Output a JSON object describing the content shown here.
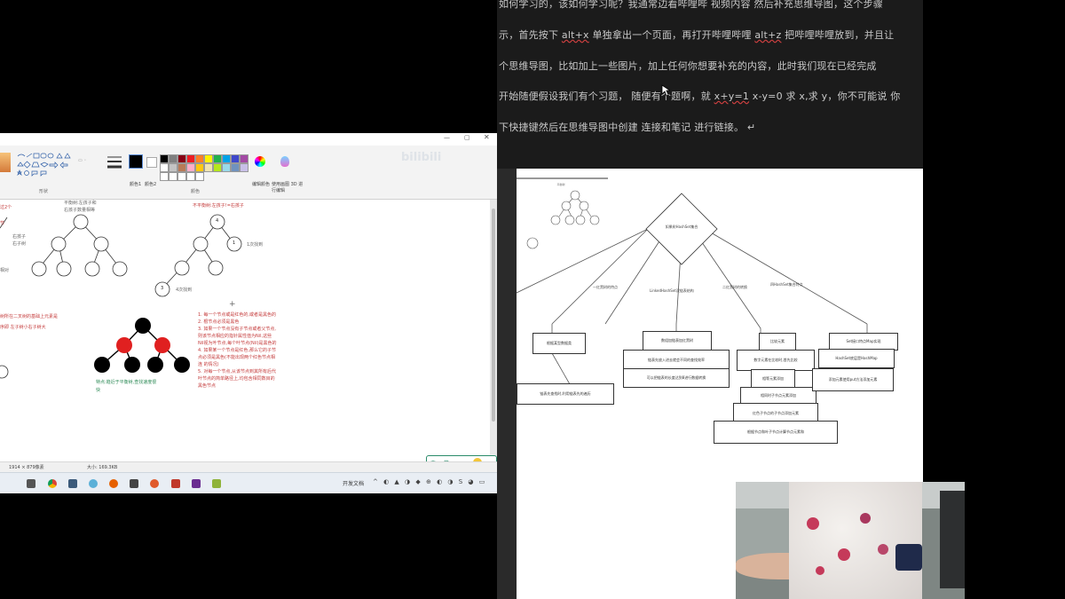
{
  "doc": {
    "line1": "如何学习的，该如何学习呢？我通常边看哔哩哔 视频内容 然后补充思维导图，这个步骤",
    "line2a": "示，首先按下",
    "key1": "alt+x",
    "line2b": "单独拿出一个页面，再打开哔哩哔哩",
    "key2": "alt+z",
    "line2c": "把哔哩哔哩放到，并且让",
    "line3": "个思维导图，比如加上一些图片，加上任何你想要补充的内容，此时我们现在已经完成",
    "line4a": "开始随便假设我们有个习题，  随便有个题啊，就",
    "line4b": "x+y=1",
    "line4c": "x-y=0  求 x,求 y，你不可能说  你",
    "line5": "下快捷键然后在思维导图中创建  连接和笔记  进行链接。 ↵"
  },
  "paint": {
    "ribbon_group_shapes": "形状",
    "ribbon_group_colors": "颜色",
    "ribbon_color1": "颜色1",
    "ribbon_color2": "颜色2",
    "ribbon_edit_colors": "编辑颜色",
    "ribbon_paint3d": "使用画图 3D 进行编辑",
    "canvas": {
      "left_t1": "过2个",
      "left_t2": "节",
      "left_child1": "右孩子",
      "left_child2": "右子树",
      "left_t3": "相对",
      "left_t4": "树所在二叉树的基础上元素是",
      "left_t5": "序即 左子树小右子树大",
      "balanced_title1": "平衡树:左孩子和",
      "balanced_title2": "右孩子数量相等",
      "unbalanced_title": "不平衡树:左孩子!=右孩子",
      "node4": "4",
      "node1": "1",
      "node1_label": "1次找到",
      "node3": "3",
      "node3_label": "4次找到",
      "rb_caption1": "特点:趋近于平衡树,查找速度很",
      "rb_caption2": "快",
      "rules": [
        "1. 每一个节点或是红色的,或者是黑色的",
        "2. 根节点必须是黑色",
        "3. 如果一个节点没有子节点或者父节点,",
        "则该节点相应的指针属性值为Nil,这些",
        "Nil视为叶节点,每个叶节点(Nil)是黑色的",
        "4. 如果某一个节点是红色,那么它的子节",
        "点必须是黑色(不能出现两个红色节点相",
        "连 的情况)",
        "5. 对每一个节点,从该节点到其所有后代",
        "叶节点的简单路径上,均包含相同数目的",
        "黑色节点"
      ]
    },
    "status_size": "1914 × 879像素",
    "status_file": "大小: 169.3KB",
    "ime_label": "中 ◐ 简",
    "watermark": "bilibili"
  },
  "taskbar": {
    "tray_text": "开发文档"
  },
  "flow": {
    "diamond": "如果树HashSet集合",
    "edge1": "一红黑树的特点",
    "edge2": "LinkedHashSet双链表结构",
    "edge3": "二红黑树的转换",
    "edge4": "四HashSet集合特点",
    "box1": "根据某型数据类",
    "box2a": "数组加链表加红黑树",
    "box2b": "链表先放入进去就会不同的查找效率",
    "box2c": "可以把链表的长度达到8进行数据转换",
    "box3a": "比较元素",
    "box3b": "数字元素在比较时,首先比较",
    "box3c": "相等元素添加",
    "box3d": "相同时子节点元素添加",
    "box3e": "红色子节点的子节点添加元素",
    "box3f": "根据节点和叶子节点计算节点元素和",
    "box4a": "Set接口特点Map实现",
    "box4b": "HashSet底层是HashMap",
    "box4c": "添加元素使用put方法添加元素",
    "box_left": "链表先查找时,利用链表先的遍历"
  },
  "colors": {
    "doc_bg": "#1b1b1b",
    "red_node": "#e02020",
    "black_node": "#000000",
    "rules_text": "#c43a3a",
    "caption_green": "#2e8b57"
  }
}
